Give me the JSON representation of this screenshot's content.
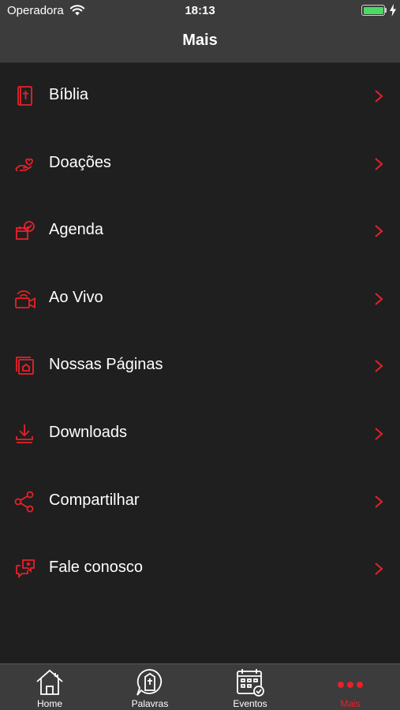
{
  "status_bar": {
    "carrier": "Operadora",
    "time": "18:13"
  },
  "nav": {
    "title": "Mais"
  },
  "menu": {
    "items": [
      {
        "label": "Bíblia",
        "icon": "bible-icon"
      },
      {
        "label": "Doações",
        "icon": "donation-hand-icon"
      },
      {
        "label": "Agenda",
        "icon": "agenda-calendar-icon"
      },
      {
        "label": "Ao Vivo",
        "icon": "live-camera-icon"
      },
      {
        "label": "Nossas Páginas",
        "icon": "pages-icon"
      },
      {
        "label": "Downloads",
        "icon": "download-icon"
      },
      {
        "label": "Compartilhar",
        "icon": "share-icon"
      },
      {
        "label": "Fale conosco",
        "icon": "chat-bubbles-icon"
      }
    ]
  },
  "tab_bar": {
    "tabs": [
      {
        "label": "Home",
        "icon": "house-icon",
        "active": false
      },
      {
        "label": "Palavras",
        "icon": "sermon-bubble-icon",
        "active": false
      },
      {
        "label": "Eventos",
        "icon": "calendar-icon",
        "active": false
      },
      {
        "label": "Mais",
        "icon": "more-dots-icon",
        "active": true
      }
    ]
  },
  "colors": {
    "accent": "#e8202a",
    "background": "#1f1f1f",
    "bars": "#3c3c3c",
    "battery": "#4cd964"
  }
}
